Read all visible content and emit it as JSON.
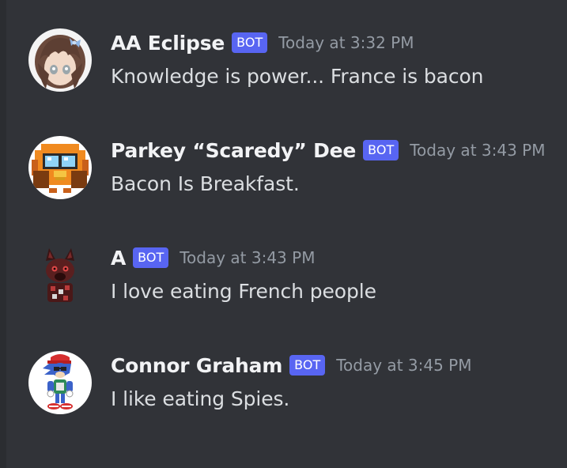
{
  "messages": [
    {
      "username": "AA Eclipse",
      "badge": "BOT",
      "timestamp": "Today at 3:32 PM",
      "content": "Knowledge is power... France is bacon",
      "avatar_icon": "anime-girl-avatar"
    },
    {
      "username": "Parkey “Scaredy” Dee",
      "badge": "BOT",
      "timestamp": "Today at 3:43 PM",
      "content": "Bacon Is Breakfast.",
      "avatar_icon": "pixel-bird-avatar"
    },
    {
      "username": "A",
      "badge": "BOT",
      "timestamp": "Today at 3:43 PM",
      "content": "I love eating French people",
      "avatar_icon": "dark-wolf-avatar"
    },
    {
      "username": "Connor Graham",
      "badge": "BOT",
      "timestamp": "Today at 3:45 PM",
      "content": "I like eating Spies.",
      "avatar_icon": "hedgehog-character-avatar"
    }
  ],
  "colors": {
    "background": "#313338",
    "bot_badge": "#5865f2",
    "username": "#f2f3f5",
    "timestamp": "#949ba4",
    "message_text": "#dbdee1"
  }
}
